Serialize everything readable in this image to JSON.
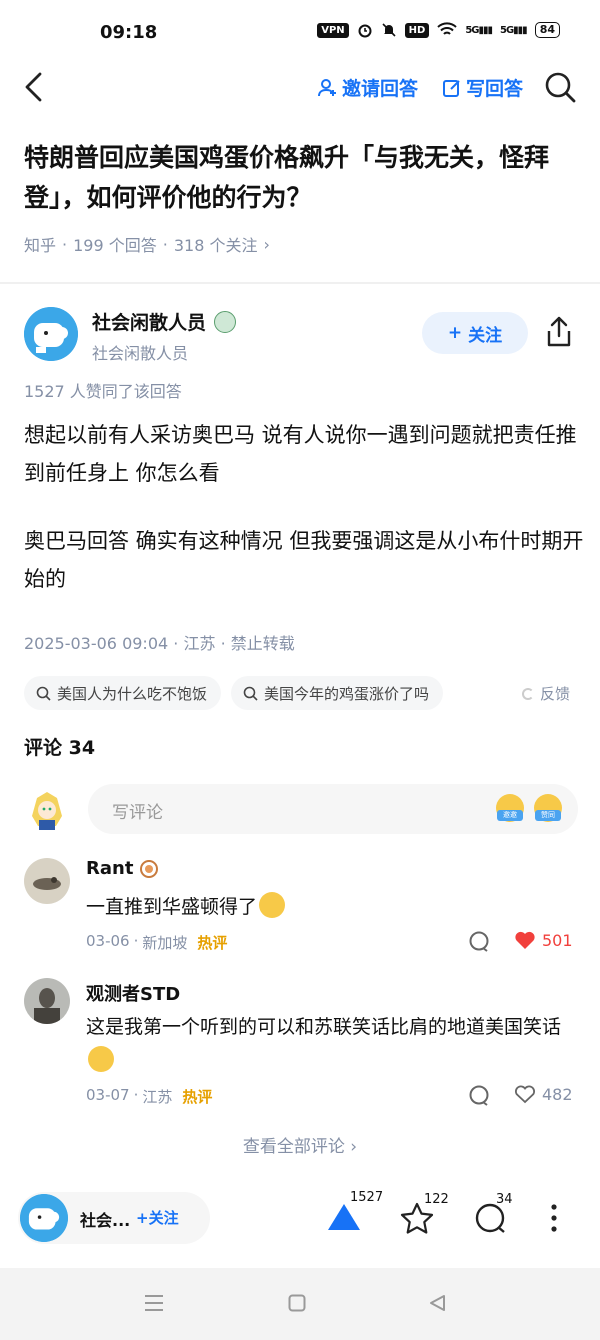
{
  "status_bar": {
    "time": "09:18",
    "vpn": "VPN",
    "hd": "HD",
    "signal_1": "5G",
    "signal_2": "5G",
    "battery": "84"
  },
  "nav": {
    "invite_label": "邀请回答",
    "write_label": "写回答"
  },
  "question": {
    "title": "特朗普回应美国鸡蛋价格飙升「与我无关，怪拜登」，如何评价他的行为？",
    "source": "知乎",
    "answers": "199 个回答",
    "followers": "318 个关注"
  },
  "author": {
    "name": "社会闲散人员",
    "subtitle": "社会闲散人员",
    "follow_label": "关注"
  },
  "answer": {
    "agree_text": "1527 人赞同了该回答",
    "paragraphs": [
      "想起以前有人采访奥巴马 说有人说你一遇到问题就把责任推到前任身上 你怎么看",
      "奥巴马回答 确实有这种情况 但我要强调这是从小布什时期开始的"
    ],
    "date": "2025-03-06 09:04",
    "location": "江苏",
    "rights": "禁止转载"
  },
  "related": {
    "chips": [
      "美国人为什么吃不饱饭",
      "美国今年的鸡蛋涨价了吗"
    ],
    "feedback": "反馈"
  },
  "comments": {
    "title": "评论 34",
    "placeholder": "写评论",
    "emoji_tag_1": "邀邀",
    "emoji_tag_2": "赞同",
    "items": [
      {
        "name": "Rant",
        "text": "一直推到华盛顿得了",
        "date": "03-06",
        "location": "新加坡",
        "tag": "热评",
        "likes": "501"
      },
      {
        "name": "观测者STD",
        "text": "这是我第一个听到的可以和苏联笑话比肩的地道美国笑话",
        "date": "03-07",
        "location": "江苏",
        "tag": "热评",
        "likes": "482"
      }
    ],
    "view_all": "查看全部评论"
  },
  "bottom_bar": {
    "author_short": "社会...",
    "follow_label": "关注",
    "upvotes": "1527",
    "favorites": "122",
    "comments": "34"
  },
  "colors": {
    "accent": "#1772f6",
    "muted": "#8590a6",
    "like_red": "#f1403c",
    "hot": "#e6a000"
  }
}
